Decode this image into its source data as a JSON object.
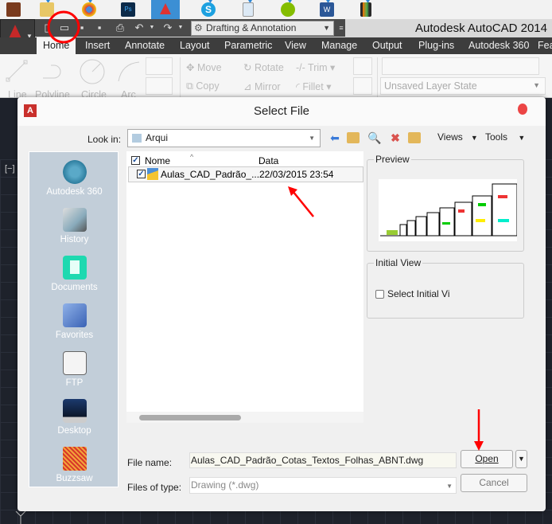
{
  "taskbar": {
    "apps": [
      {
        "name": "domo-app"
      },
      {
        "name": "file-explorer"
      },
      {
        "name": "chrome"
      },
      {
        "name": "photoshop"
      },
      {
        "name": "autocad",
        "active": true
      },
      {
        "name": "skype"
      },
      {
        "name": "notepad"
      },
      {
        "name": "spotify"
      },
      {
        "name": "word"
      },
      {
        "name": "video-app"
      }
    ]
  },
  "app": {
    "title": "Autodesk AutoCAD 2014",
    "workspace": "Drafting & Annotation",
    "qat_icons": [
      "new-icon",
      "open-icon",
      "save-icon",
      "save-as-icon",
      "plot-icon",
      "undo-icon",
      "redo-icon"
    ]
  },
  "ribbon": {
    "tabs": [
      "Home",
      "Insert",
      "Annotate",
      "Layout",
      "Parametric",
      "View",
      "Manage",
      "Output",
      "Plug-ins",
      "Autodesk 360",
      "Fea"
    ],
    "active_tab": "Home",
    "draw_tools": [
      "Line",
      "Polyline",
      "Circle",
      "Arc"
    ],
    "modify_tools": [
      "Move",
      "Rotate",
      "Trim",
      "Copy",
      "Mirror",
      "Fillet"
    ],
    "layer_state": "Unsaved Layer State"
  },
  "canvas": {
    "viewport_label": "[−]"
  },
  "dialog": {
    "title": "Select File",
    "look_in_label": "Look in:",
    "look_in_value": "Arqui",
    "toolbar": {
      "icons": [
        "back-icon",
        "up-folder-icon",
        "search-web-icon",
        "delete-icon",
        "new-folder-icon"
      ],
      "views_label": "Views",
      "tools_label": "Tools"
    },
    "places": [
      "Autodesk 360",
      "History",
      "Documents",
      "Favorites",
      "FTP",
      "Desktop",
      "Buzzsaw"
    ],
    "columns": {
      "name": "Nome",
      "date": "Data"
    },
    "files": [
      {
        "name": "Aulas_CAD_Padrão_...",
        "date": "22/03/2015 23:54",
        "checked": true
      }
    ],
    "preview_label": "Preview",
    "initial_view_label": "Initial View",
    "select_initial_view": "Select Initial Vi",
    "file_name_label": "File name:",
    "file_name_value": "Aulas_CAD_Padrão_Cotas_Textos_Folhas_ABNT.dwg",
    "files_of_type_label": "Files of type:",
    "files_of_type_value": "Drawing (*.dwg)",
    "open_label": "Open",
    "cancel_label": "Cancel"
  },
  "colors": {
    "annotation_red": "#ff0000",
    "places_bg": "#c2ced9",
    "autocad_red": "#c9302c"
  }
}
